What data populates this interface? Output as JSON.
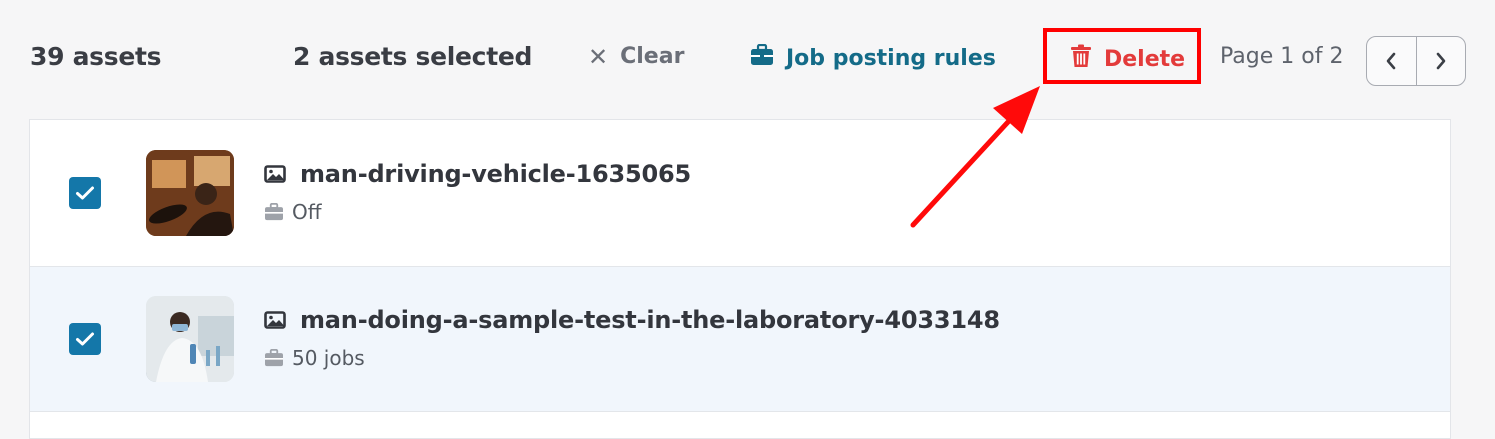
{
  "toolbar": {
    "asset_count": "39 assets",
    "selected_text": "2 assets selected",
    "clear_label": "Clear",
    "job_rules_label": "Job posting rules",
    "delete_label": "Delete",
    "page_info": "Page 1 of 2"
  },
  "assets": [
    {
      "name": "man-driving-vehicle-1635065",
      "job_status": "Off",
      "checked": true
    },
    {
      "name": "man-doing-a-sample-test-in-the-laboratory-4033148",
      "job_status": "50 jobs",
      "checked": true
    }
  ],
  "colors": {
    "accent_blue": "#146b88",
    "checkbox_blue": "#1477a9",
    "delete_red": "#e33b3b",
    "highlight_red": "#ff0000",
    "selected_row_bg": "#f1f6fc"
  },
  "icons": {
    "clear": "close-icon",
    "job_rules": "briefcase-icon",
    "delete": "trash-icon",
    "prev": "chevron-left-icon",
    "next": "chevron-right-icon",
    "asset_type": "image-icon",
    "job_status": "briefcase-icon",
    "checkbox": "checkmark-icon"
  }
}
